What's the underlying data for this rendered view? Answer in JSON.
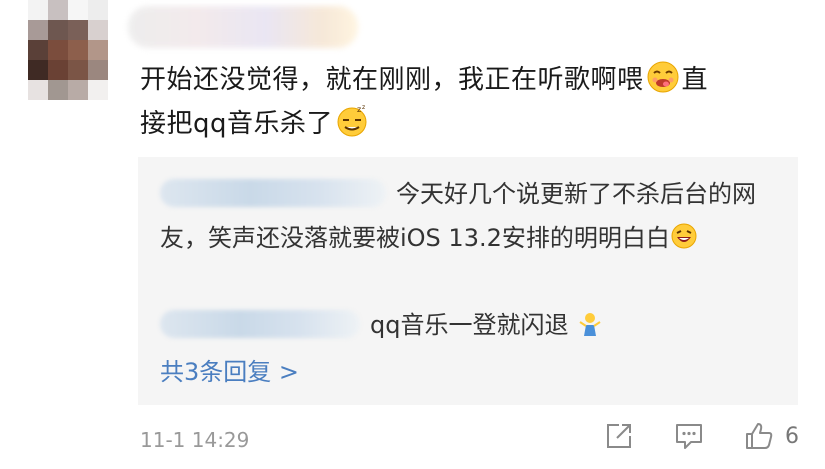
{
  "comment": {
    "text_line1": "开始还没觉得，就在刚刚，我正在听歌啊喂",
    "text_line1_after": "直",
    "text_line2": "接把qq音乐杀了",
    "emoji_1": "yum-face-icon",
    "emoji_2": "sleepy-face-icon"
  },
  "replies": {
    "reply1_text": "今天好几个说更新了不杀后台的网友，笑声还没落就要被iOS 13.2安排的明明白白",
    "reply1_emoji": "laughing-face-icon",
    "reply2_text": "qq音乐一登就闪退",
    "reply2_emoji": "shrug-figure-icon",
    "more_label": "共3条回复 >"
  },
  "footer": {
    "timestamp": "11-1 14:29",
    "share_icon": "share-icon",
    "comment_icon": "comment-icon",
    "like_icon": "thumbs-up-icon",
    "like_count": "6"
  },
  "colors": {
    "link": "#4a7ec0",
    "muted": "#999999",
    "reply_bg": "#f5f5f5"
  }
}
